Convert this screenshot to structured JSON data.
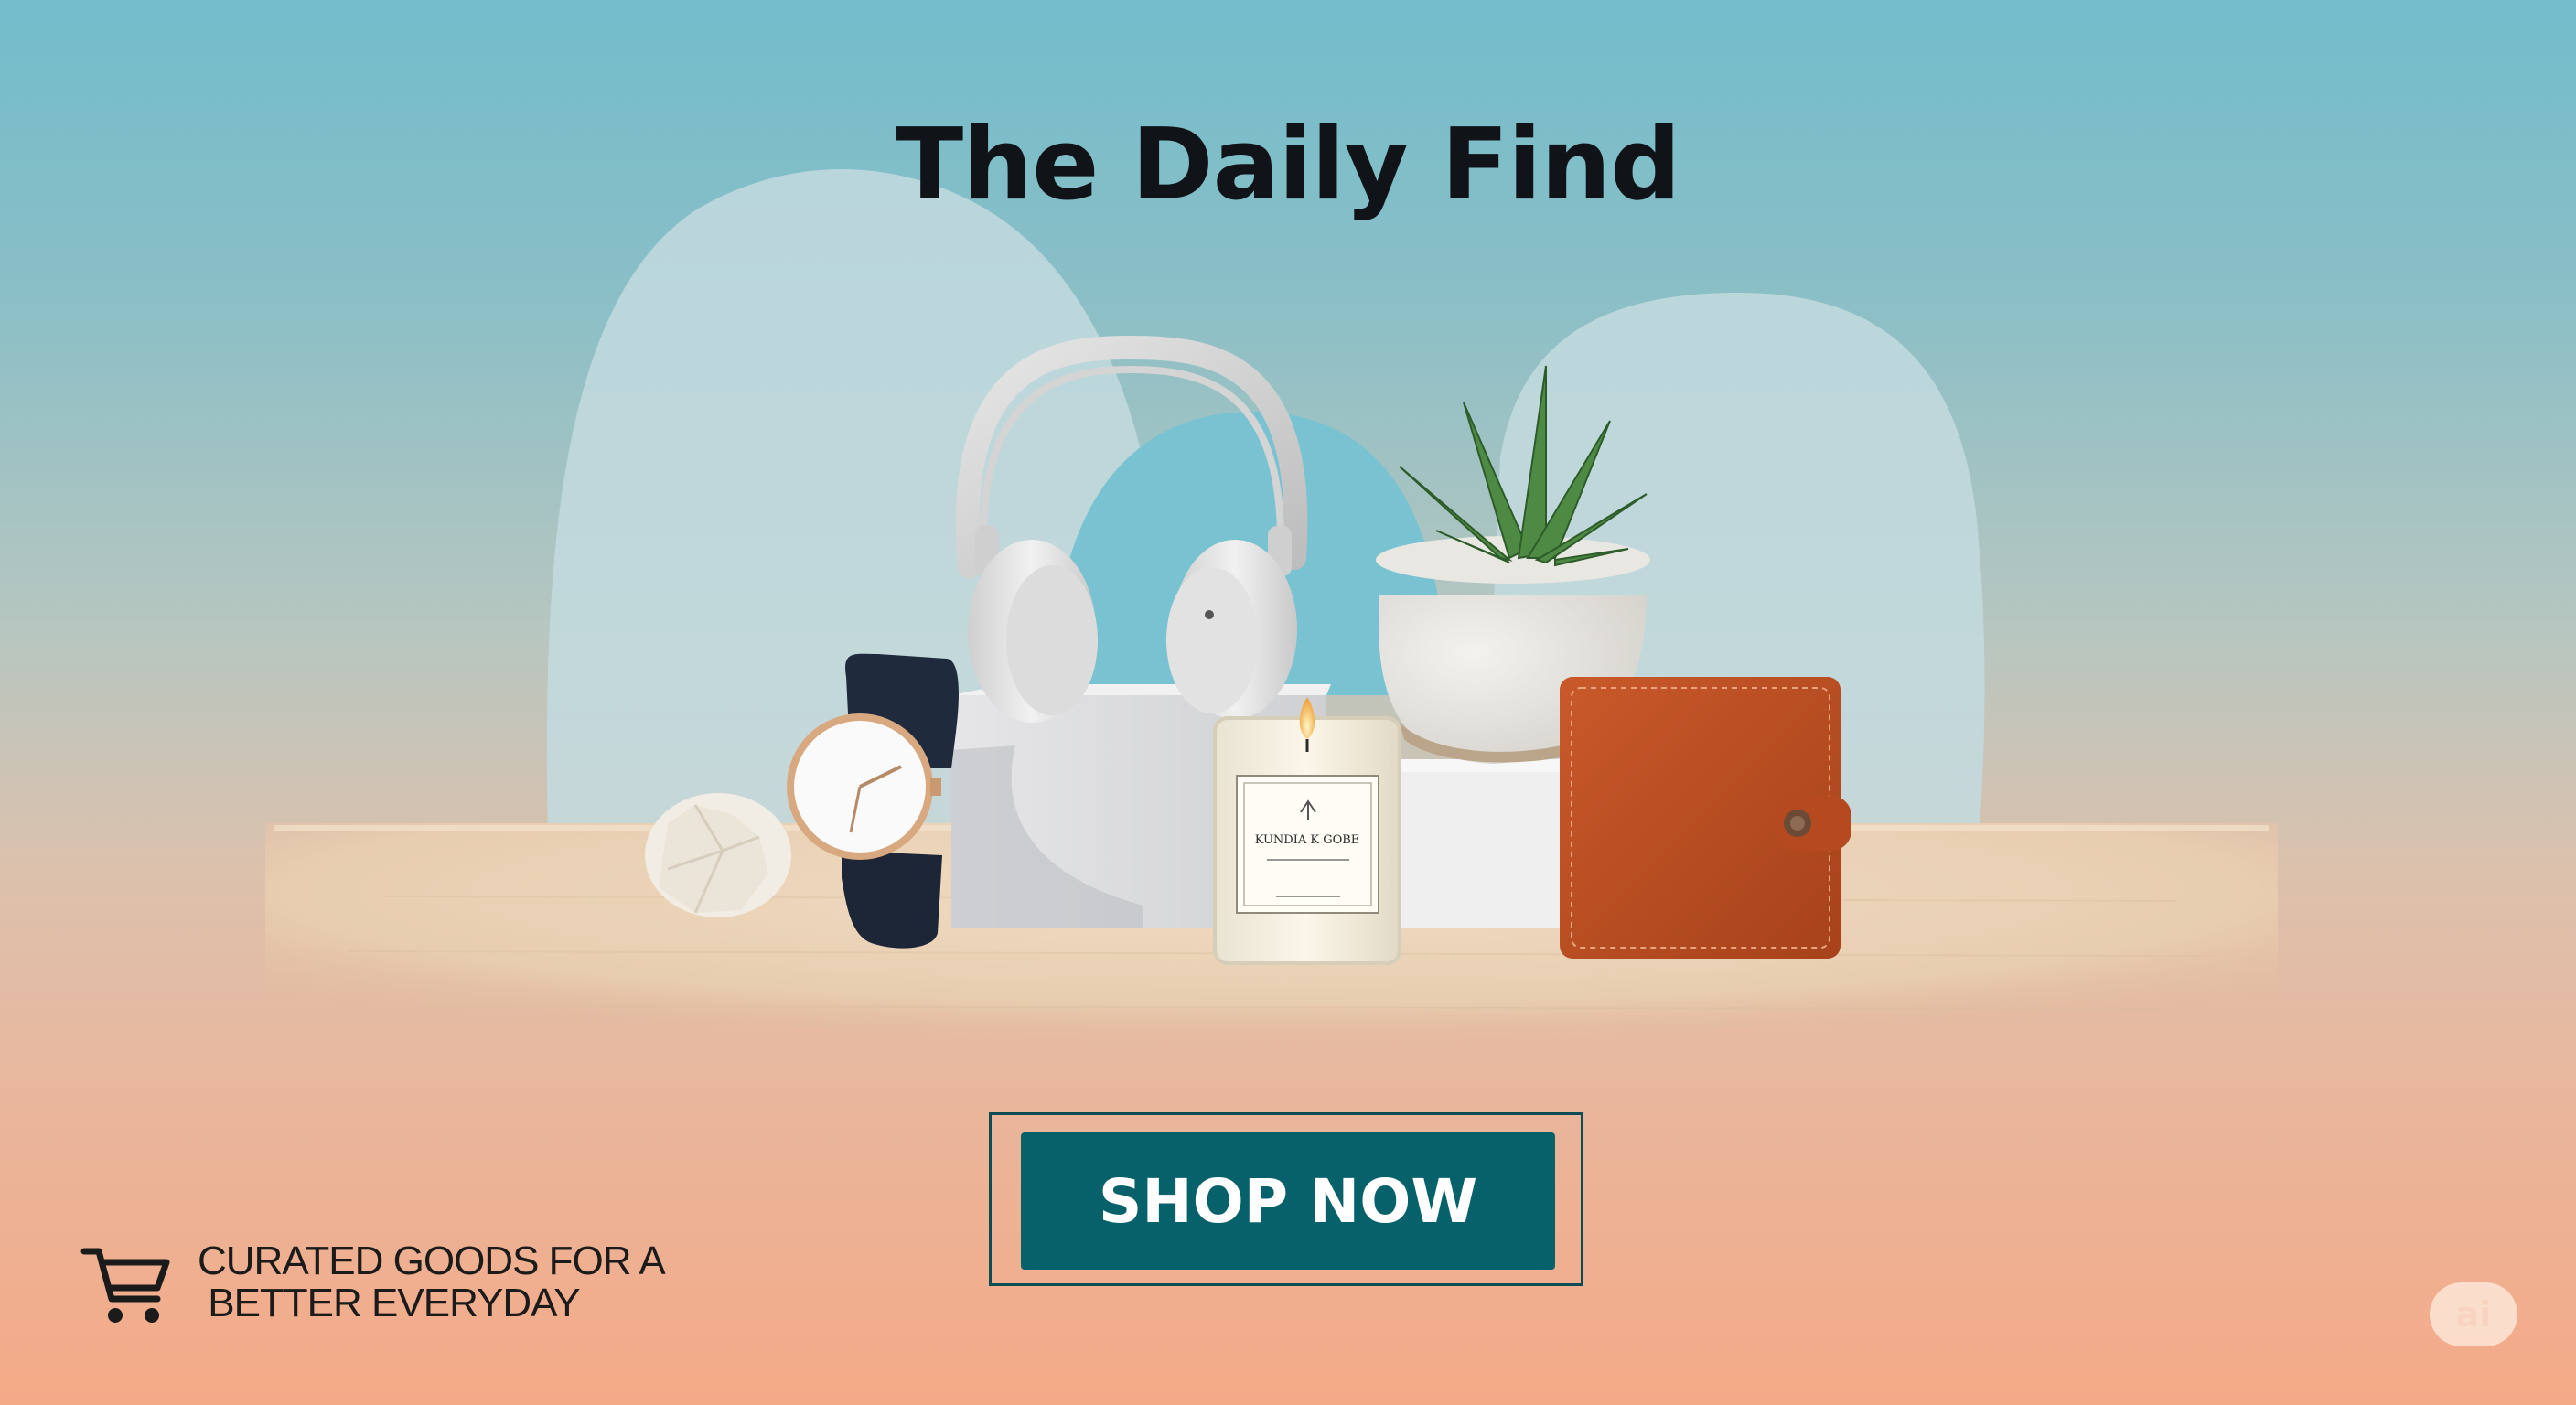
{
  "banner": {
    "headline": "The Daily Find",
    "cta_label": "SHOP NOW",
    "tagline_line1": "CURATED GOODS FOR A",
    "tagline_line2": " BETTER EVERYDAY",
    "badge_text": "ai"
  },
  "products": {
    "candle_label": "KUNDIA K GOBE"
  },
  "icons": [
    "shopping-cart-icon"
  ],
  "colors": {
    "cta_background": "#06616a",
    "cta_border": "#0c4d55",
    "headline": "#101418",
    "background_top": "#72bccb",
    "background_bottom": "#f4aa87"
  }
}
